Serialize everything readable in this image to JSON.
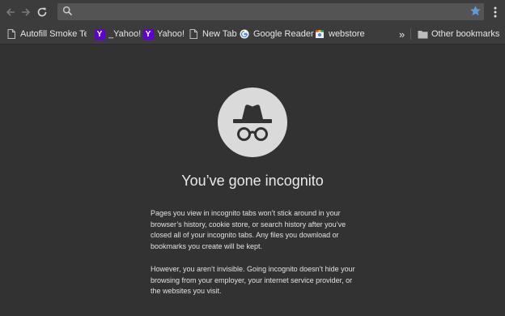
{
  "bookmarks": [
    {
      "label": "Autofill Smoke Te",
      "icon": "page-icon"
    },
    {
      "label": "_Yahoo!",
      "icon": "yahoo-icon"
    },
    {
      "label": "Yahoo!",
      "icon": "yahoo-icon"
    },
    {
      "label": "New Tab",
      "icon": "page-icon"
    },
    {
      "label": "Google Reader",
      "icon": "google-icon"
    },
    {
      "label": "webstore",
      "icon": "webstore-icon"
    }
  ],
  "bookmarks_overflow": "»",
  "other_bookmarks": {
    "label": "Other bookmarks",
    "icon": "folder-icon"
  },
  "omnibox": {
    "value": ""
  },
  "incognito": {
    "headline": "You’ve gone incognito",
    "paragraph1": "Pages you view in incognito tabs won’t stick around in your browser’s history, cookie store, or search history after you’ve closed all of your incognito tabs. Any files you download or bookmarks you create will be kept.",
    "paragraph2": "However, you aren’t invisible. Going incognito doesn’t hide your browsing from your employer, your internet service provider, or the websites you visit."
  },
  "colors": {
    "background": "#323232",
    "toolbar": "#3c3c3c",
    "badge": "#dadada",
    "star": "#5f9bd9",
    "yahoo": "#5f01d1"
  }
}
